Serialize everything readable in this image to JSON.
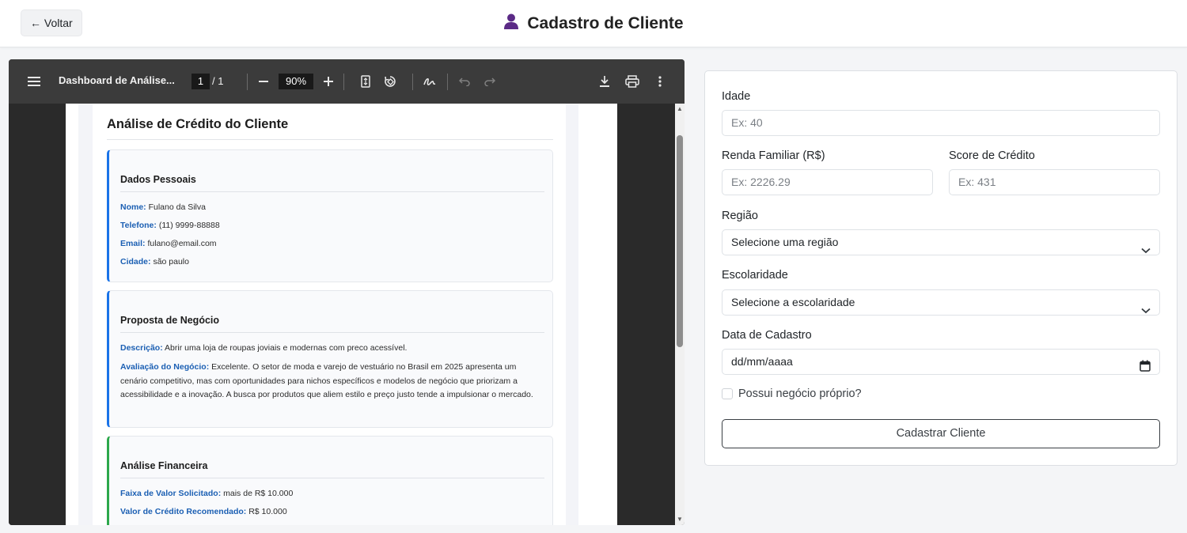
{
  "header": {
    "back_label": "← Voltar",
    "title": "Cadastro de Cliente"
  },
  "pdf_viewer": {
    "doc_title": "Dashboard de Análise...",
    "page_current": "1",
    "page_total": "/ 1",
    "zoom": "90%",
    "report": {
      "title": "Análise de Crédito do Cliente",
      "sections": [
        {
          "heading": "Dados Pessoais",
          "rows": [
            {
              "label": "Nome:",
              "value": "Fulano da Silva"
            },
            {
              "label": "Telefone:",
              "value": "(11) 9999-88888"
            },
            {
              "label": "Email:",
              "value": "fulano@email.com"
            },
            {
              "label": "Cidade:",
              "value": "são paulo"
            }
          ]
        },
        {
          "heading": "Proposta de Negócio",
          "rows": [
            {
              "label": "Descrição:",
              "value": "Abrir uma loja de roupas joviais e modernas com preco acessível."
            },
            {
              "label": "Avaliação do Negócio:",
              "value": "Excelente. O setor de moda e varejo de vestuário no Brasil em 2025 apresenta um cenário competitivo, mas com oportunidades para nichos específicos e modelos de negócio que priorizam a acessibilidade e a inovação. A busca por produtos que aliem estilo e preço justo tende a impulsionar o mercado."
            }
          ]
        },
        {
          "heading": "Análise Financeira",
          "rows": [
            {
              "label": "Faixa de Valor Solicitado:",
              "value": "mais de R$ 10.000"
            },
            {
              "label": "Valor de Crédito Recomendado:",
              "value": "R$ 10.000"
            }
          ]
        }
      ]
    }
  },
  "form": {
    "idade": {
      "label": "Idade",
      "placeholder": "Ex: 40"
    },
    "renda": {
      "label": "Renda Familiar (R$)",
      "placeholder": "Ex: 2226.29"
    },
    "score": {
      "label": "Score de Crédito",
      "placeholder": "Ex: 431"
    },
    "regiao": {
      "label": "Região",
      "selected": "Selecione uma região"
    },
    "escolaridade": {
      "label": "Escolaridade",
      "selected": "Selecione a escolaridade"
    },
    "data": {
      "label": "Data de Cadastro",
      "value": "dd/mm/aaaa"
    },
    "negocio": {
      "label": "Possui negócio próprio?"
    },
    "submit_label": "Cadastrar Cliente"
  },
  "colors": {
    "accent_blue": "#1a73e8",
    "accent_green": "#2ca84b",
    "title_icon": "#5b2a86"
  }
}
